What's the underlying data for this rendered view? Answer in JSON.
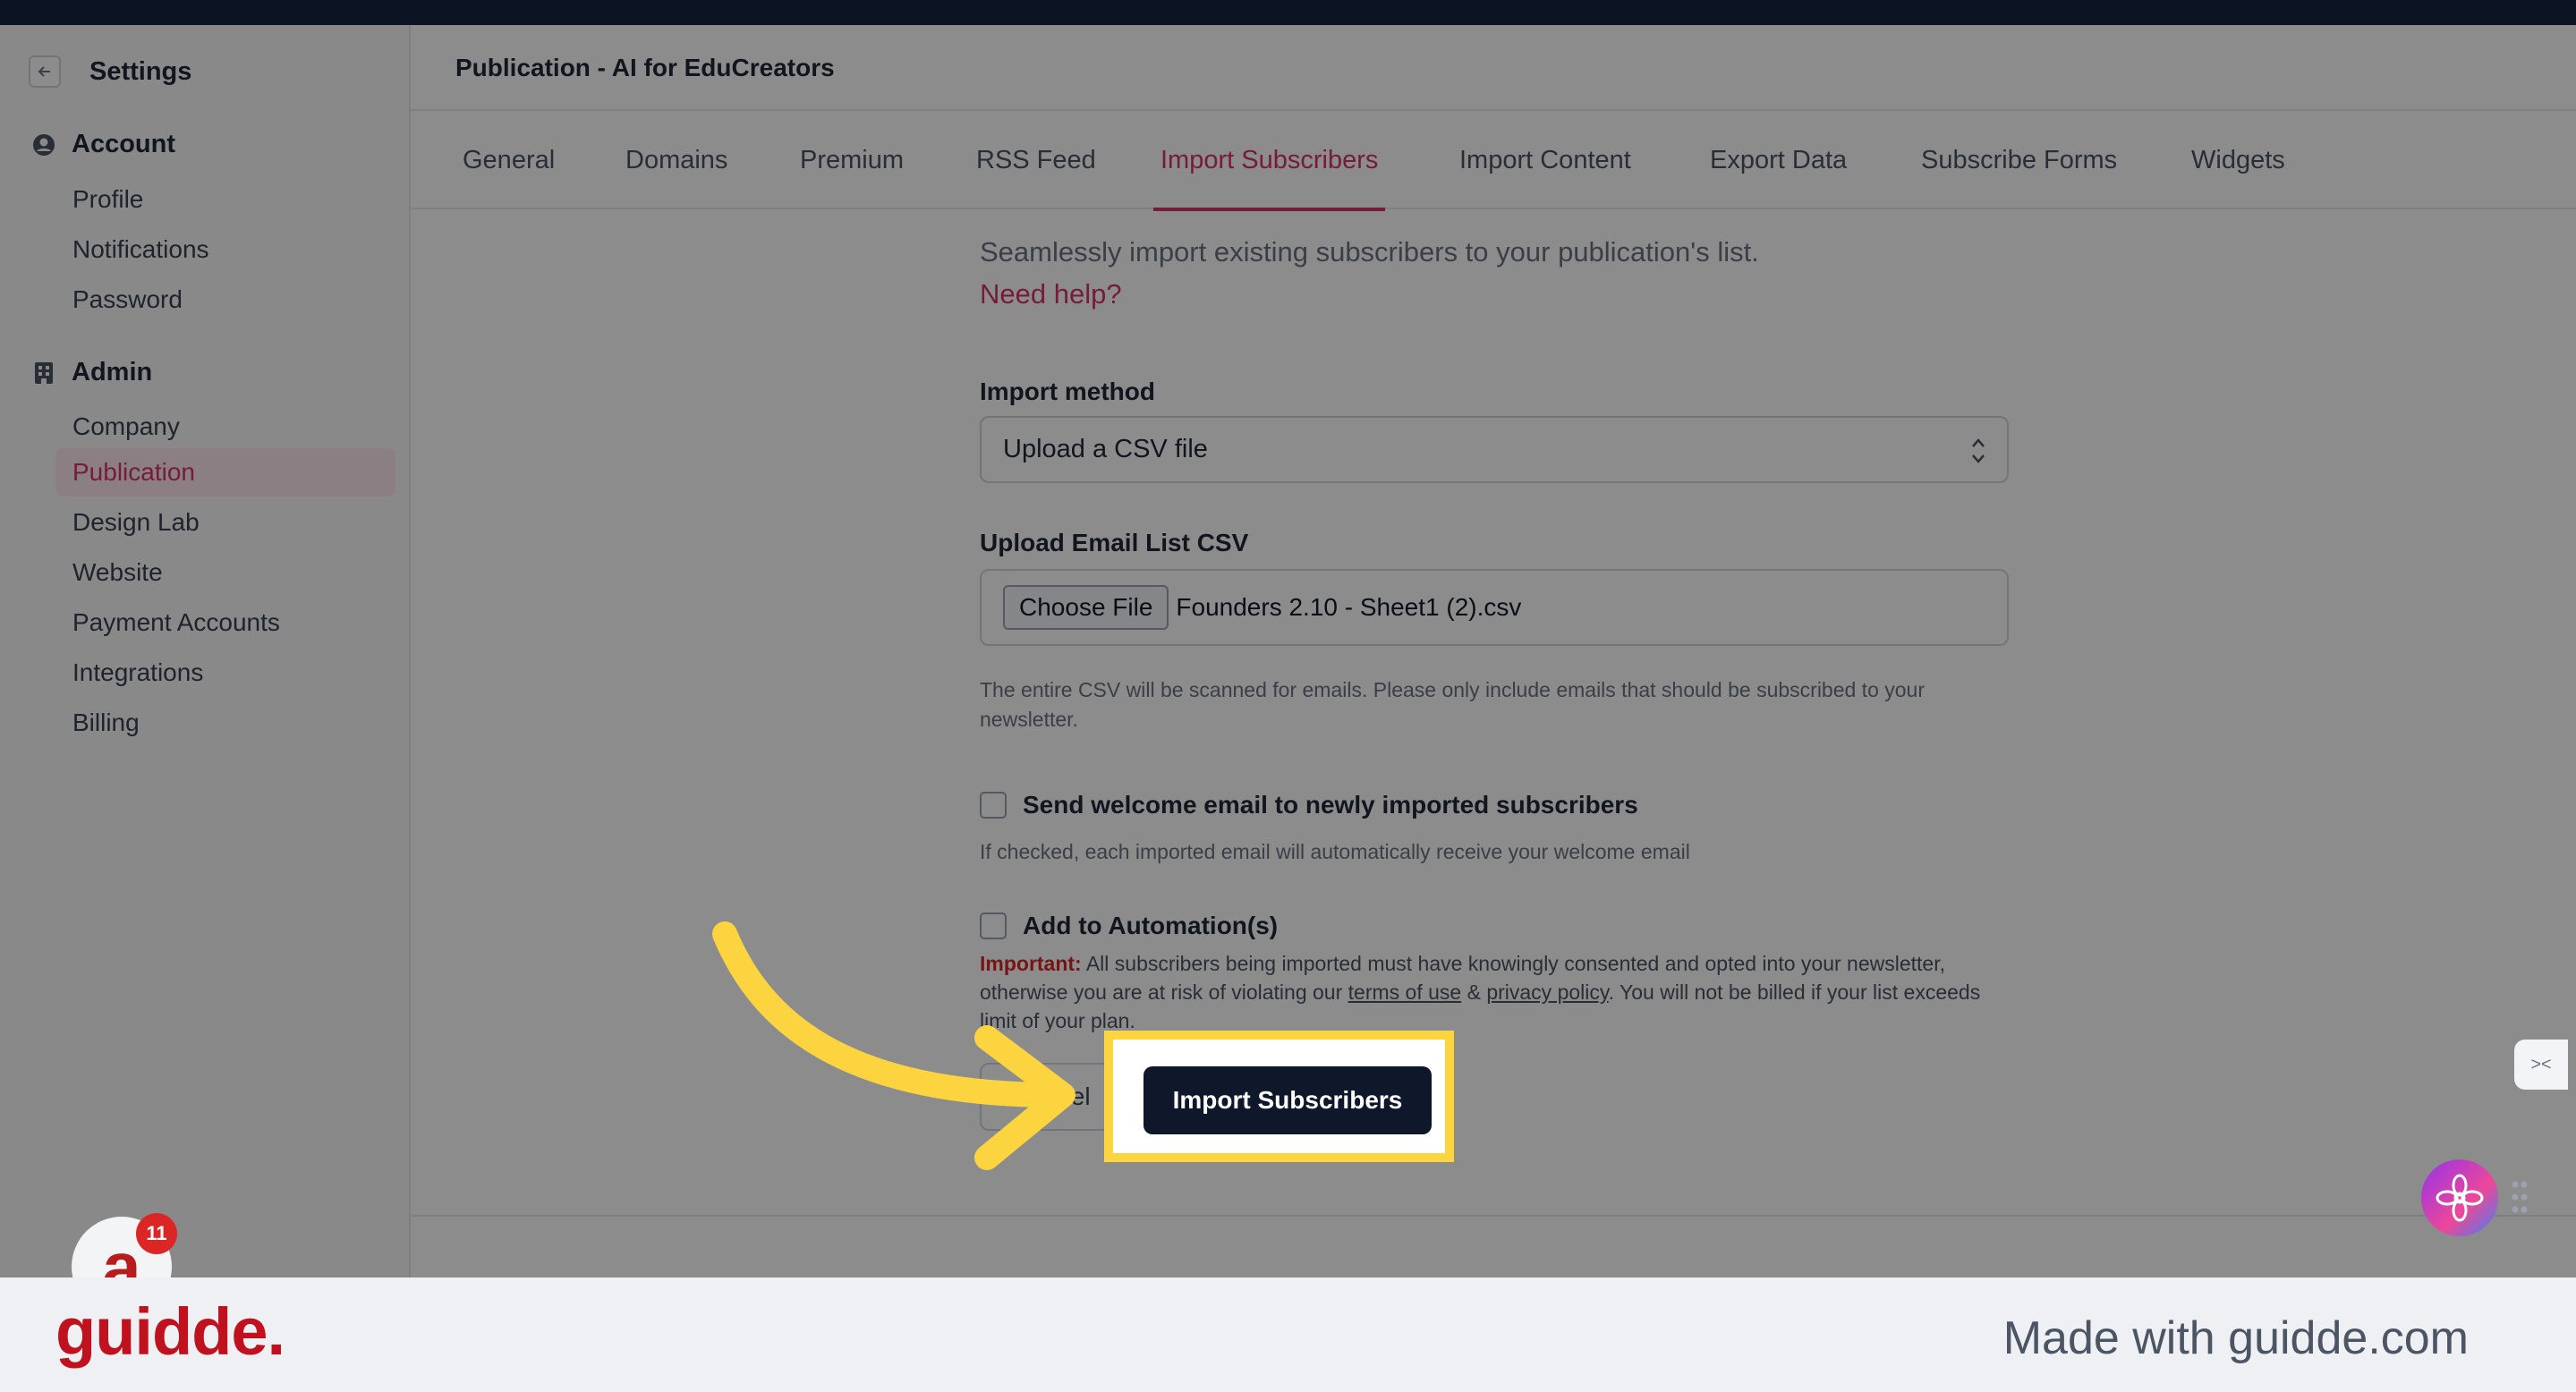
{
  "sidebar": {
    "title": "Settings",
    "sections": [
      {
        "label": "Account",
        "icon": "user-circle-icon",
        "items": [
          "Profile",
          "Notifications",
          "Password"
        ]
      },
      {
        "label": "Admin",
        "icon": "building-icon",
        "items": [
          "Company",
          "Publication",
          "Design Lab",
          "Website",
          "Payment Accounts",
          "Integrations",
          "Billing"
        ]
      }
    ],
    "active_item": "Publication"
  },
  "header": {
    "title": "Publication - AI for EduCreators"
  },
  "tabs": [
    "General",
    "Domains",
    "Premium",
    "RSS Feed",
    "Import Subscribers",
    "Import Content",
    "Export Data",
    "Subscribe Forms",
    "Widgets"
  ],
  "active_tab": "Import Subscribers",
  "form": {
    "subtitle": "Seamlessly import existing subscribers to your publication's list.",
    "help_link": "Need help?",
    "import_method_label": "Import method",
    "import_method_value": "Upload a CSV file",
    "upload_label": "Upload Email List CSV",
    "choose_file_label": "Choose File",
    "file_name": "Founders 2.10 - Sheet1 (2).csv",
    "csv_note": "The entire CSV will be scanned for emails. Please only include emails that should be subscribed to your newsletter.",
    "welcome_label": "Send welcome email to newly imported subscribers",
    "welcome_checked": false,
    "welcome_note": "If checked, each imported email will automatically receive your welcome email",
    "automation_label": "Add to Automation(s)",
    "automation_checked": false,
    "important_label": "Important:",
    "important_text_1": " All subscribers being imported must have knowingly consented and opted into your newsletter, otherwise you are at risk of violating our ",
    "terms_link": "terms of use",
    "amp": " & ",
    "privacy_link": "privacy policy",
    "important_text_2": ". You will not be billed if your list exceeds limit of your plan.",
    "cancel_label": "Cancel",
    "import_button_label": "Import Subscribers"
  },
  "notification_count": "11",
  "avatar_letter": "a",
  "footer": {
    "logo": "guidde.",
    "made_with": "Made with guidde.com"
  },
  "colors": {
    "accent": "#d6336c",
    "highlight": "#fcd440",
    "button": "#0f172a",
    "brand": "#c0111f"
  }
}
